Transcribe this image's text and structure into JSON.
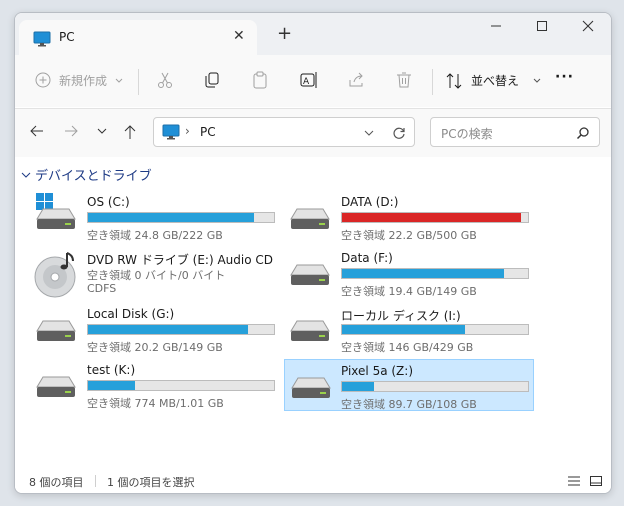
{
  "window": {
    "tab_title": "PC",
    "tab_close": "✕",
    "new_tab": "+"
  },
  "toolbar": {
    "new_label": "新規作成",
    "sort_label": "並べ替え",
    "more_label": "···"
  },
  "nav": {
    "address_separator": "›",
    "address_text": "PC",
    "search_placeholder": "PCの検索"
  },
  "group": {
    "title": "デバイスとドライブ"
  },
  "drives": [
    {
      "name": "OS (C:)",
      "space": "空き領域 24.8 GB/222 GB",
      "used_fraction": 0.89,
      "bar_color": "#26a0da"
    },
    {
      "name": "DATA (D:)",
      "space": "空き領域 22.2 GB/500 GB",
      "used_fraction": 0.96,
      "bar_color": "#da2626"
    },
    {
      "name": "DVD RW ドライブ (E:) Audio CD",
      "space": "空き領域 0 バイト/0 バイト",
      "fs": "CDFS"
    },
    {
      "name": "Data (F:)",
      "space": "空き領域 19.4 GB/149 GB",
      "used_fraction": 0.87,
      "bar_color": "#26a0da"
    },
    {
      "name": "Local Disk (G:)",
      "space": "空き領域 20.2 GB/149 GB",
      "used_fraction": 0.86,
      "bar_color": "#26a0da"
    },
    {
      "name": "ローカル ディスク (I:)",
      "space": "空き領域 146 GB/429 GB",
      "used_fraction": 0.66,
      "bar_color": "#26a0da"
    },
    {
      "name": "test (K:)",
      "space": "空き領域 774 MB/1.01 GB",
      "used_fraction": 0.25,
      "bar_color": "#26a0da"
    },
    {
      "name": "Pixel 5a (Z:)",
      "space": "空き領域 89.7 GB/108 GB",
      "used_fraction": 0.17,
      "bar_color": "#26a0da"
    }
  ],
  "status": {
    "item_count": "8 個の項目",
    "selected": "1 個の項目を選択"
  },
  "colors": {
    "accent": "#26a0da",
    "danger": "#da2626",
    "selection": "#cce8ff"
  }
}
